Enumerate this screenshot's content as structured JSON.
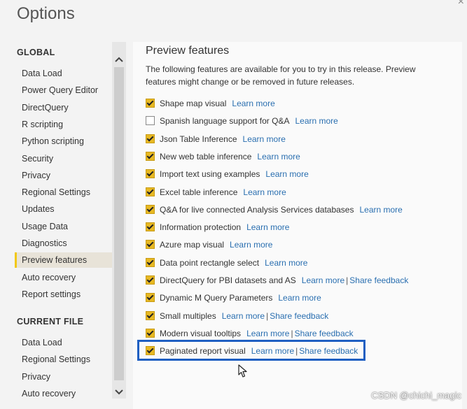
{
  "window": {
    "title": "Options",
    "close_glyph": "×"
  },
  "nav": {
    "global_header": "GLOBAL",
    "global_items": [
      {
        "label": "Data Load"
      },
      {
        "label": "Power Query Editor"
      },
      {
        "label": "DirectQuery"
      },
      {
        "label": "R scripting"
      },
      {
        "label": "Python scripting"
      },
      {
        "label": "Security"
      },
      {
        "label": "Privacy"
      },
      {
        "label": "Regional Settings"
      },
      {
        "label": "Updates"
      },
      {
        "label": "Usage Data"
      },
      {
        "label": "Diagnostics"
      },
      {
        "label": "Preview features",
        "selected": true
      },
      {
        "label": "Auto recovery"
      },
      {
        "label": "Report settings"
      }
    ],
    "current_file_header": "CURRENT FILE",
    "current_file_items": [
      {
        "label": "Data Load"
      },
      {
        "label": "Regional Settings"
      },
      {
        "label": "Privacy"
      },
      {
        "label": "Auto recovery"
      }
    ]
  },
  "pane": {
    "title": "Preview features",
    "description": "The following features are available for you to try in this release. Preview features might change or be removed in future releases.",
    "features": [
      {
        "label": "Shape map visual",
        "checked": true,
        "link": "Learn more"
      },
      {
        "label": "Spanish language support for Q&A",
        "checked": false,
        "link": "Learn more"
      },
      {
        "label": "Json Table Inference",
        "checked": true,
        "link": "Learn more"
      },
      {
        "label": "New web table inference",
        "checked": true,
        "link": "Learn more"
      },
      {
        "label": "Import text using examples",
        "checked": true,
        "link": "Learn more"
      },
      {
        "label": "Excel table inference",
        "checked": true,
        "link": "Learn more"
      },
      {
        "label": "Q&A for live connected Analysis Services databases",
        "checked": true,
        "link": "Learn more"
      },
      {
        "label": "Information protection",
        "checked": true,
        "link": "Learn more"
      },
      {
        "label": "Azure map visual",
        "checked": true,
        "link": "Learn more"
      },
      {
        "label": "Data point rectangle select",
        "checked": true,
        "link": "Learn more"
      },
      {
        "label": "DirectQuery for PBI datasets and AS",
        "checked": true,
        "link": "Learn more",
        "link2": "Share feedback"
      },
      {
        "label": "Dynamic M Query Parameters",
        "checked": true,
        "link": "Learn more"
      },
      {
        "label": "Small multiples",
        "checked": true,
        "link": "Learn more",
        "link2": "Share feedback"
      },
      {
        "label": "Modern visual tooltips",
        "checked": true,
        "link": "Learn more",
        "link2": "Share feedback"
      },
      {
        "label": "Paginated report visual",
        "checked": true,
        "link": "Learn more",
        "link2": "Share feedback"
      }
    ],
    "separator": "|"
  },
  "watermark": "CSDN @chichi_magic",
  "colors": {
    "accent_yellow": "#f2c811",
    "checkbox_fill": "#e8b923",
    "link": "#2a6fb0",
    "highlight_border": "#1f5fc2"
  },
  "icons": {
    "scroll_up": "chevron-up-icon",
    "scroll_down": "chevron-down-icon",
    "cursor": "mouse-pointer-icon"
  }
}
